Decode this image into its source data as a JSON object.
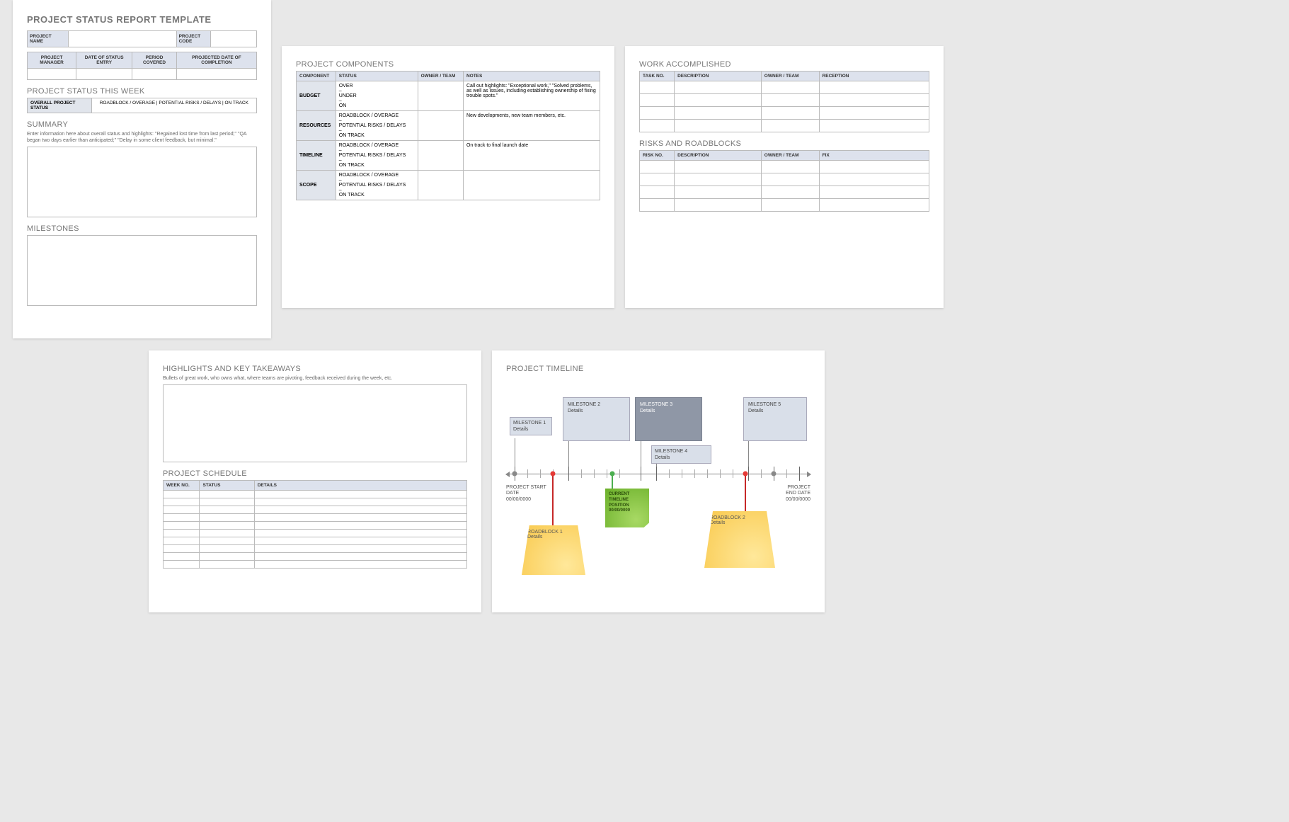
{
  "page1": {
    "title": "PROJECT STATUS REPORT TEMPLATE",
    "project_name_label": "PROJECT NAME",
    "project_code_label": "PROJECT CODE",
    "cols": {
      "pm": "PROJECT MANAGER",
      "date_entry": "DATE OF STATUS ENTRY",
      "period": "PERIOD COVERED",
      "projected": "PROJECTED DATE OF COMPLETION"
    },
    "status_week_title": "PROJECT STATUS THIS WEEK",
    "overall_label": "OVERALL PROJECT STATUS",
    "overall_options": "ROADBLOCK / OVERAGE    |    POTENTIAL RISKS / DELAYS    |    ON TRACK",
    "summary_title": "SUMMARY",
    "summary_hint": "Enter information here about overall status and highlights: \"Regained lost time from last period;\" \"QA began two days earlier than anticipated;\" \"Delay in some client feedback, but minimal.\"",
    "milestones_title": "MILESTONES"
  },
  "page2": {
    "title": "PROJECT COMPONENTS",
    "cols": {
      "component": "COMPONENT",
      "status": "STATUS",
      "owner": "OWNER / TEAM",
      "notes": "NOTES"
    },
    "rows": [
      {
        "component": "BUDGET",
        "status": "OVER\n–\nUNDER\n–\nON",
        "notes": "Call out highlights: \"Exceptional work,\" \"Solved problems, as well as issues, including establishing ownership of fixing trouble spots.\""
      },
      {
        "component": "RESOURCES",
        "status": "ROADBLOCK / OVERAGE\n–\nPOTENTIAL RISKS / DELAYS\n–\nON TRACK",
        "notes": "New developments, new team members, etc."
      },
      {
        "component": "TIMELINE",
        "status": "ROADBLOCK / OVERAGE\n–\nPOTENTIAL RISKS / DELAYS\n–\nON TRACK",
        "notes": "On track to final launch date"
      },
      {
        "component": "SCOPE",
        "status": "ROADBLOCK / OVERAGE\n–\nPOTENTIAL RISKS / DELAYS\n–\nON TRACK",
        "notes": ""
      }
    ]
  },
  "page3": {
    "work_title": "WORK ACCOMPLISHED",
    "work_cols": {
      "task": "TASK NO.",
      "desc": "DESCRIPTION",
      "owner": "OWNER / TEAM",
      "reception": "RECEPTION"
    },
    "risks_title": "RISKS AND ROADBLOCKS",
    "risks_cols": {
      "risk": "RISK NO.",
      "desc": "DESCRIPTION",
      "owner": "OWNER / TEAM",
      "fix": "FIX"
    }
  },
  "page4": {
    "highlights_title": "HIGHLIGHTS AND KEY TAKEAWAYS",
    "highlights_hint": "Bullets of great work, who owns what, where teams are pivoting, feedback received during the week, etc.",
    "schedule_title": "PROJECT SCHEDULE",
    "schedule_cols": {
      "week": "WEEK NO.",
      "status": "STATUS",
      "details": "DETAILS"
    }
  },
  "page5": {
    "title": "PROJECT TIMELINE",
    "m1": {
      "t": "MILESTONE 1",
      "d": "Details"
    },
    "m2": {
      "t": "MILESTONE 2",
      "d": "Details"
    },
    "m3": {
      "t": "MILESTONE 3",
      "d": "Details"
    },
    "m4": {
      "t": "MILESTONE 4",
      "d": "Details"
    },
    "m5": {
      "t": "MILESTONE 5",
      "d": "Details"
    },
    "start": {
      "l1": "PROJECT START",
      "l2": "DATE",
      "l3": "00/00/0000"
    },
    "end": {
      "l1": "PROJECT",
      "l2": "END DATE",
      "l3": "00/00/0000"
    },
    "current": {
      "l1": "CURRENT",
      "l2": "TIMELINE",
      "l3": "POSITION",
      "l4": "00/00/0000"
    },
    "rb1": {
      "t": "ROADBLOCK 1",
      "d": "Details"
    },
    "rb2": {
      "t": "ROADBLOCK 2",
      "d": "Details"
    }
  }
}
